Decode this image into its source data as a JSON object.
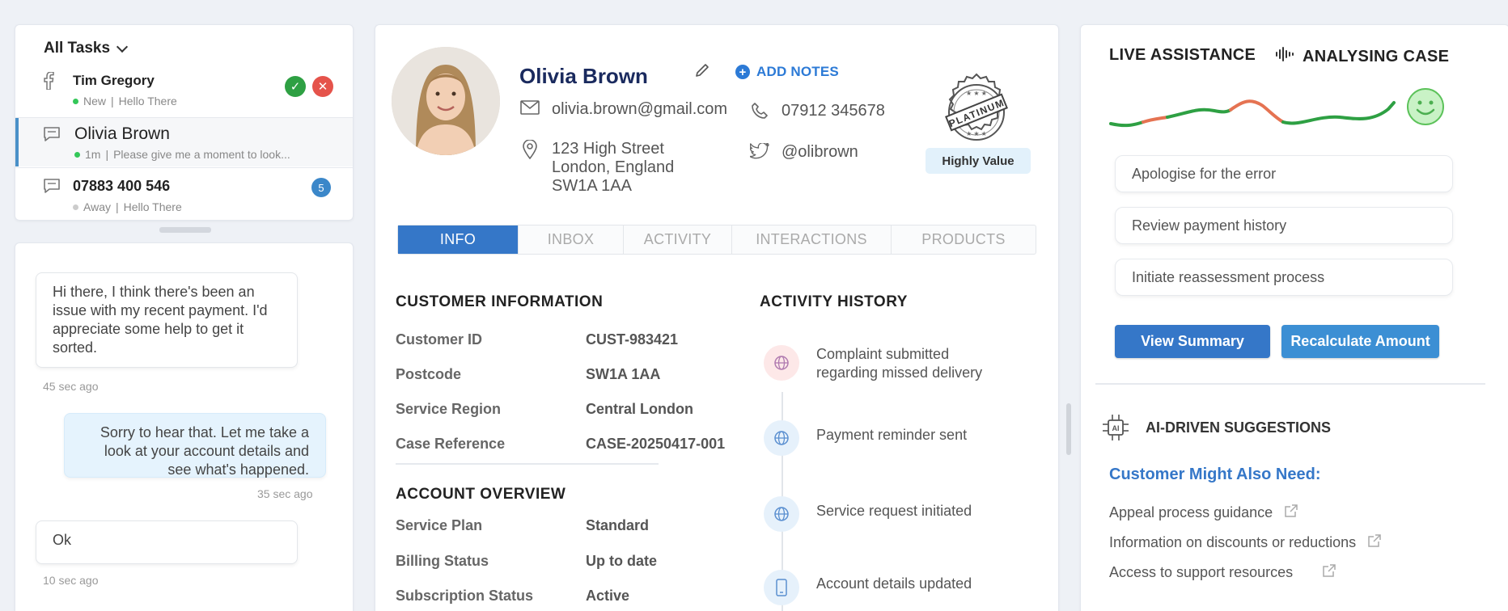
{
  "tasks": {
    "header": "All Tasks",
    "items": [
      {
        "name": "Tim Gregory",
        "status": "New",
        "preview": "Hello There",
        "status_color": "#34c759"
      },
      {
        "name": "Olivia Brown",
        "status": "1m",
        "preview": "Please give me a moment to look...",
        "status_color": "#34c759"
      },
      {
        "name": "07883 400 546",
        "status": "Away",
        "preview": "Hello There",
        "badge": "5",
        "status_color": "#cccccc"
      }
    ]
  },
  "chat": {
    "messages": [
      {
        "direction": "in",
        "text": "Hi there, I think there's been an issue with my recent payment. I'd appreciate some help to get it sorted.",
        "time": "45 sec ago"
      },
      {
        "direction": "out",
        "text": "Sorry to hear that. Let me take a look at your account details and see what's happened.",
        "time": "35 sec ago"
      },
      {
        "direction": "in",
        "text": "Ok",
        "time": "10 sec ago"
      }
    ]
  },
  "customer": {
    "name": "Olivia Brown",
    "add_notes_label": "ADD NOTES",
    "email": "olivia.brown@gmail.com",
    "phone": "07912 345678",
    "address_line1": "123 High Street",
    "address_line2": "London, England",
    "address_line3": "SW1A 1AA",
    "twitter": "@olibrown",
    "tier_stamp": "PLATINUM",
    "tier_badge": "Highly Value"
  },
  "tabs": [
    "INFO",
    "INBOX",
    "ACTIVITY",
    "INTERACTIONS",
    "PRODUCTS"
  ],
  "customer_info": {
    "title": "CUSTOMER INFORMATION",
    "rows": [
      {
        "label": "Customer ID",
        "value": "CUST-983421"
      },
      {
        "label": "Postcode",
        "value": "SW1A 1AA"
      },
      {
        "label": "Service Region",
        "value": "Central London"
      },
      {
        "label": "Case Reference",
        "value": "CASE-20250417-001"
      }
    ]
  },
  "account_overview": {
    "title": "ACCOUNT OVERVIEW",
    "rows": [
      {
        "label": "Service Plan",
        "value": "Standard"
      },
      {
        "label": "Billing Status",
        "value": "Up to date"
      },
      {
        "label": "Subscription Status",
        "value": "Active"
      }
    ]
  },
  "activity_history": {
    "title": "ACTIVITY HISTORY",
    "items": [
      {
        "icon": "globe-icon",
        "text_line1": "Complaint submitted",
        "text_line2": "regarding missed delivery"
      },
      {
        "icon": "globe-icon",
        "text_line1": "Payment reminder sent",
        "text_line2": ""
      },
      {
        "icon": "globe-icon",
        "text_line1": "Service request initiated",
        "text_line2": ""
      },
      {
        "icon": "phone-icon",
        "text_line1": "Account details updated",
        "text_line2": ""
      }
    ]
  },
  "assistance": {
    "live_title": "LIVE ASSISTANCE",
    "analysing_title": "ANALYSING CASE",
    "suggestions": [
      "Apologise for the error",
      "Review payment history",
      "Initiate reassessment process"
    ],
    "view_summary": "View Summary",
    "recalculate": "Recalculate Amount"
  },
  "ai": {
    "title": "AI-DRIVEN SUGGESTIONS",
    "might_need": "Customer Might Also Need:",
    "links": [
      "Appeal process guidance",
      "Information on discounts or reductions",
      "Access to support resources"
    ]
  },
  "colors": {
    "accent": "#3577c8",
    "link_blue": "#2c7ad6",
    "accept_green": "#2ea043",
    "reject_red": "#e5534b",
    "sentiment_green": "#2ea043",
    "sentiment_red": "#e57352"
  }
}
